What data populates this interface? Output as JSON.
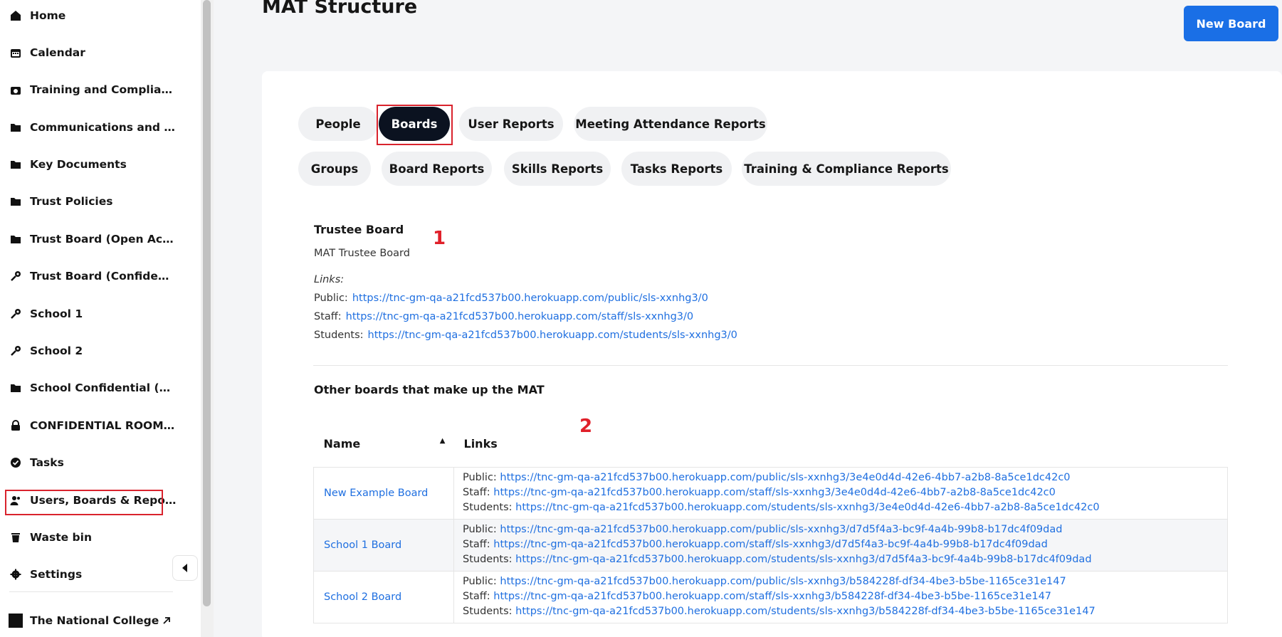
{
  "sidebar": {
    "items": [
      {
        "label": "Home",
        "icon": "home-icon"
      },
      {
        "label": "Calendar",
        "icon": "calendar-icon"
      },
      {
        "label": "Training and Complianc...",
        "icon": "training-icon"
      },
      {
        "label": "Communications and Op...",
        "icon": "folder-icon"
      },
      {
        "label": "Key Documents",
        "icon": "folder-icon"
      },
      {
        "label": "Trust Policies",
        "icon": "folder-icon"
      },
      {
        "label": "Trust Board (Open Acces...",
        "icon": "folder-icon"
      },
      {
        "label": "Trust Board (Confidential)",
        "icon": "key-icon"
      },
      {
        "label": "School 1",
        "icon": "key-icon"
      },
      {
        "label": "School 2",
        "icon": "key-icon"
      },
      {
        "label": "School Confidential (Ope...",
        "icon": "folder-icon"
      },
      {
        "label": "CONFIDENTIAL ROOM (Pri...",
        "icon": "lock-icon"
      },
      {
        "label": "Tasks",
        "icon": "check-circle-icon"
      },
      {
        "label": "Users, Boards & Reports",
        "icon": "users-icon"
      },
      {
        "label": "Waste bin",
        "icon": "trash-icon"
      },
      {
        "label": "Settings",
        "icon": "gear-icon"
      }
    ],
    "college": "The National College",
    "college_logo_text": "The National College"
  },
  "header": {
    "title": "MAT Structure",
    "new_board": "New Board"
  },
  "tabs": [
    {
      "label": "People",
      "active": false
    },
    {
      "label": "Boards",
      "active": true
    },
    {
      "label": "User Reports",
      "active": false
    },
    {
      "label": "Meeting Attendance Reports",
      "active": false
    },
    {
      "label": "Groups",
      "active": false
    },
    {
      "label": "Board Reports",
      "active": false
    },
    {
      "label": "Skills Reports",
      "active": false
    },
    {
      "label": "Tasks Reports",
      "active": false
    },
    {
      "label": "Training & Compliance Reports",
      "active": false
    }
  ],
  "trustee": {
    "heading": "Trustee Board",
    "board_name": "MAT Trustee Board",
    "links_label": "Links:",
    "public_label": "Public:",
    "public_url": "https://tnc-gm-qa-a21fcd537b00.herokuapp.com/public/sls-xxnhg3/0",
    "staff_label": "Staff:",
    "staff_url": "https://tnc-gm-qa-a21fcd537b00.herokuapp.com/staff/sls-xxnhg3/0",
    "students_label": "Students:",
    "students_url": "https://tnc-gm-qa-a21fcd537b00.herokuapp.com/students/sls-xxnhg3/0"
  },
  "other": {
    "heading": "Other boards that make up the MAT",
    "col_name": "Name",
    "col_links": "Links",
    "rows": [
      {
        "name": "New Example Board",
        "public": "https://tnc-gm-qa-a21fcd537b00.herokuapp.com/public/sls-xxnhg3/3e4e0d4d-42e6-4bb7-a2b8-8a5ce1dc42c0",
        "staff": "https://tnc-gm-qa-a21fcd537b00.herokuapp.com/staff/sls-xxnhg3/3e4e0d4d-42e6-4bb7-a2b8-8a5ce1dc42c0",
        "students": "https://tnc-gm-qa-a21fcd537b00.herokuapp.com/students/sls-xxnhg3/3e4e0d4d-42e6-4bb7-a2b8-8a5ce1dc42c0"
      },
      {
        "name": "School 1 Board",
        "public": "https://tnc-gm-qa-a21fcd537b00.herokuapp.com/public/sls-xxnhg3/d7d5f4a3-bc9f-4a4b-99b8-b17dc4f09dad",
        "staff": "https://tnc-gm-qa-a21fcd537b00.herokuapp.com/staff/sls-xxnhg3/d7d5f4a3-bc9f-4a4b-99b8-b17dc4f09dad",
        "students": "https://tnc-gm-qa-a21fcd537b00.herokuapp.com/students/sls-xxnhg3/d7d5f4a3-bc9f-4a4b-99b8-b17dc4f09dad"
      },
      {
        "name": "School 2 Board",
        "public": "https://tnc-gm-qa-a21fcd537b00.herokuapp.com/public/sls-xxnhg3/b584228f-df34-4be3-b5be-1165ce31e147",
        "staff": "https://tnc-gm-qa-a21fcd537b00.herokuapp.com/staff/sls-xxnhg3/b584228f-df34-4be3-b5be-1165ce31e147",
        "students": "https://tnc-gm-qa-a21fcd537b00.herokuapp.com/students/sls-xxnhg3/b584228f-df34-4be3-b5be-1165ce31e147"
      }
    ]
  },
  "annotations": {
    "marker1": "1",
    "marker2": "2"
  },
  "colors": {
    "accent": "#1a6fe6",
    "active_tab": "#0b1220",
    "highlight": "#d9232d",
    "link": "#1f6fe0"
  }
}
